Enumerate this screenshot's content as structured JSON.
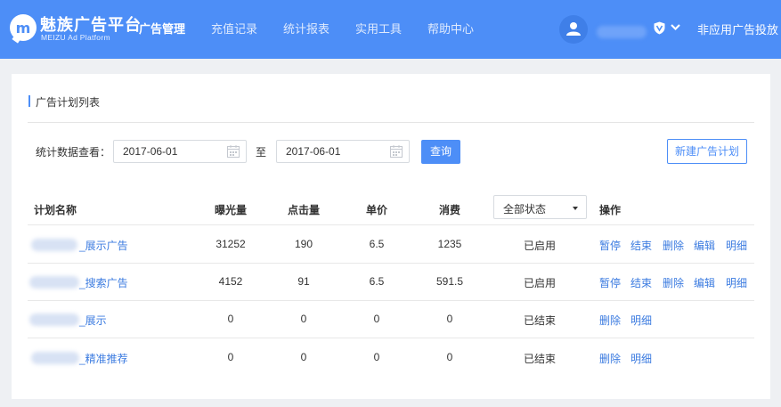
{
  "header": {
    "brand_title": "魅族广告平台",
    "brand_subtitle": "MEIZU Ad Platform",
    "logo_letter": "m",
    "nav": [
      "广告管理",
      "充值记录",
      "统计报表",
      "实用工具",
      "帮助中心"
    ],
    "active_nav": "广告管理",
    "nonapp_link": "非应用广告投放",
    "colors": {
      "brand_blue": "#4d8ef7",
      "link_blue": "#3b7be0"
    }
  },
  "card": {
    "title": "广告计划列表",
    "filter_label": "统计数据查看：",
    "date_start": "2017-06-01",
    "date_to": "至",
    "date_end": "2017-06-01",
    "query_button": "查询",
    "new_button": "新建广告计划"
  },
  "table": {
    "headers": {
      "name": "计划名称",
      "impressions": "曝光量",
      "clicks": "点击量",
      "price": "单价",
      "spend": "消费",
      "ops": "操作"
    },
    "status_filter": "全部状态",
    "rows": [
      {
        "name": "_展示广告",
        "impressions": "31252",
        "clicks": "190",
        "price": "6.5",
        "spend": "1235",
        "status": "已启用",
        "ops": [
          "暂停",
          "结束",
          "删除",
          "编辑",
          "明细"
        ]
      },
      {
        "name": "_搜索广告",
        "impressions": "4152",
        "clicks": "91",
        "price": "6.5",
        "spend": "591.5",
        "status": "已启用",
        "ops": [
          "暂停",
          "结束",
          "删除",
          "编辑",
          "明细"
        ]
      },
      {
        "name": "_展示",
        "impressions": "0",
        "clicks": "0",
        "price": "0",
        "spend": "0",
        "status": "已结束",
        "ops": [
          "删除",
          "明细"
        ]
      },
      {
        "name": "_精准推荐",
        "impressions": "0",
        "clicks": "0",
        "price": "0",
        "spend": "0",
        "status": "已结束",
        "ops": [
          "删除",
          "明细"
        ]
      }
    ]
  }
}
